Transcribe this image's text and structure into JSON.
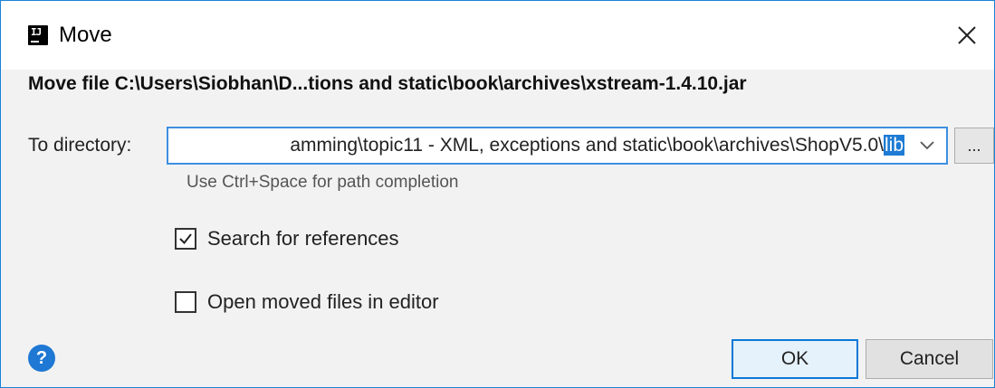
{
  "window": {
    "title": "Move",
    "app_icon_text": "IJ"
  },
  "header": {
    "text": "Move file C:\\Users\\Siobhan\\D...tions and static\\book\\archives\\xstream-1.4.10.jar"
  },
  "directory": {
    "label": "To directory:",
    "value_prefix": "amming\\topic11 - XML, exceptions and static\\book\\archives\\ShopV5.0\\",
    "value_selected": "lib",
    "browse_label": "...",
    "hint": "Use Ctrl+Space for path completion"
  },
  "options": {
    "search_references": {
      "label": "Search for references",
      "checked": true
    },
    "open_in_editor": {
      "label": "Open moved files in editor",
      "checked": false
    }
  },
  "buttons": {
    "ok": "OK",
    "cancel": "Cancel",
    "help": "?"
  },
  "colors": {
    "accent": "#1e7bd4",
    "border": "#1883d7"
  }
}
